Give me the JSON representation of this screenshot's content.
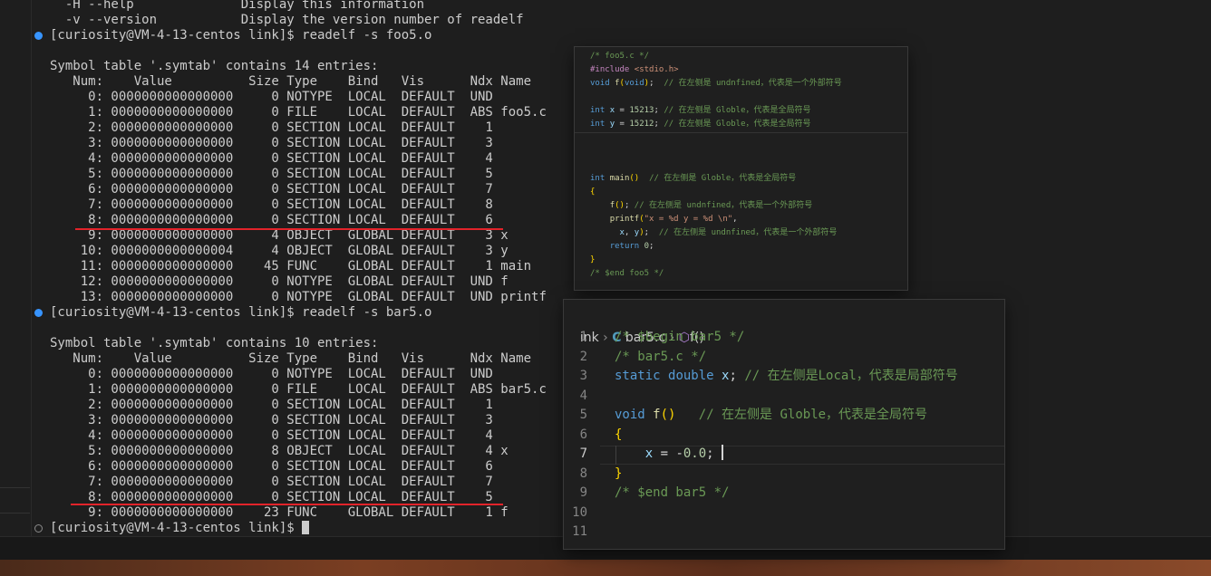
{
  "terminal": {
    "lines": [
      {
        "text": "  -H --help              Display this information",
        "y": -3
      },
      {
        "text": "  -v --version           Display the version number of readelf"
      },
      {
        "text": "[curiosity@VM-4-13-centos link]$ readelf -s foo5.o",
        "prompt": true
      },
      {
        "text": ""
      },
      {
        "text": "Symbol table '.symtab' contains 14 entries:"
      },
      {
        "text": "   Num:    Value          Size Type    Bind   Vis      Ndx Name"
      },
      {
        "text": "     0: 0000000000000000     0 NOTYPE  LOCAL  DEFAULT  UND"
      },
      {
        "text": "     1: 0000000000000000     0 FILE    LOCAL  DEFAULT  ABS foo5.c"
      },
      {
        "text": "     2: 0000000000000000     0 SECTION LOCAL  DEFAULT    1"
      },
      {
        "text": "     3: 0000000000000000     0 SECTION LOCAL  DEFAULT    3"
      },
      {
        "text": "     4: 0000000000000000     0 SECTION LOCAL  DEFAULT    4"
      },
      {
        "text": "     5: 0000000000000000     0 SECTION LOCAL  DEFAULT    5"
      },
      {
        "text": "     6: 0000000000000000     0 SECTION LOCAL  DEFAULT    7"
      },
      {
        "text": "     7: 0000000000000000     0 SECTION LOCAL  DEFAULT    8"
      },
      {
        "text": "     8: 0000000000000000     0 SECTION LOCAL  DEFAULT    6"
      },
      {
        "text": "     9: 0000000000000000     4 OBJECT  GLOBAL DEFAULT    3 x"
      },
      {
        "text": "    10: 0000000000000004     4 OBJECT  GLOBAL DEFAULT    3 y"
      },
      {
        "text": "    11: 0000000000000000    45 FUNC    GLOBAL DEFAULT    1 main"
      },
      {
        "text": "    12: 0000000000000000     0 NOTYPE  GLOBAL DEFAULT  UND f"
      },
      {
        "text": "    13: 0000000000000000     0 NOTYPE  GLOBAL DEFAULT  UND printf"
      },
      {
        "text": "[curiosity@VM-4-13-centos link]$ readelf -s bar5.o",
        "prompt": true
      },
      {
        "text": ""
      },
      {
        "text": "Symbol table '.symtab' contains 10 entries:"
      },
      {
        "text": "   Num:    Value          Size Type    Bind   Vis      Ndx Name"
      },
      {
        "text": "     0: 0000000000000000     0 NOTYPE  LOCAL  DEFAULT  UND"
      },
      {
        "text": "     1: 0000000000000000     0 FILE    LOCAL  DEFAULT  ABS bar5.c"
      },
      {
        "text": "     2: 0000000000000000     0 SECTION LOCAL  DEFAULT    1"
      },
      {
        "text": "     3: 0000000000000000     0 SECTION LOCAL  DEFAULT    3"
      },
      {
        "text": "     4: 0000000000000000     0 SECTION LOCAL  DEFAULT    4"
      },
      {
        "text": "     5: 0000000000000000     8 OBJECT  LOCAL  DEFAULT    4 x"
      },
      {
        "text": "     6: 0000000000000000     0 SECTION LOCAL  DEFAULT    6"
      },
      {
        "text": "     7: 0000000000000000     0 SECTION LOCAL  DEFAULT    7"
      },
      {
        "text": "     8: 0000000000000000     0 SECTION LOCAL  DEFAULT    5"
      },
      {
        "text": "     9: 0000000000000000    23 FUNC    GLOBAL DEFAULT    1 f"
      },
      {
        "text": "[curiosity@VM-4-13-centos link]$ ",
        "prompt": true,
        "cursor": true,
        "inactive": true
      }
    ]
  },
  "small_editor": {
    "lines": [
      "/* foo5.c */",
      "#include <stdio.h>",
      "void f(void);  // 在左侧是 undnfined，代表是一个外部符号",
      "",
      "int x = 15213; // 在左侧是 Globle，代表是全局符号",
      "int y = 15212; // 在左侧是 Globle，代表是全局符号",
      "",
      "",
      "",
      "int main()  // 在左侧是 Globle，代表是全局符号",
      "{",
      "    f(); // 在左侧是 undnfined，代表是一个外部符号",
      "    printf(\"x = %d y = %d \\n\",",
      "      x, y);  // 在左侧是 undnfined，代表是一个外部符号",
      "    return 0;",
      "}",
      "/* $end foo5 */"
    ]
  },
  "large_editor": {
    "breadcrumb": {
      "folder": "ink",
      "file_icon": "C",
      "file": "bar5.c",
      "symbol": "f()"
    },
    "lines": [
      {
        "num": "1",
        "text": "/* $begin bar5 */"
      },
      {
        "num": "2",
        "text": "/* bar5.c */"
      },
      {
        "num": "3",
        "text": "static double x; // 在左侧是Local，代表是局部符号"
      },
      {
        "num": "4",
        "text": ""
      },
      {
        "num": "5",
        "text": "void f()   // 在左侧是 Globle，代表是全局符号"
      },
      {
        "num": "6",
        "text": "{"
      },
      {
        "num": "7",
        "text": "    x = -0.0; "
      },
      {
        "num": "8",
        "text": "}"
      },
      {
        "num": "9",
        "text": "/* $end bar5 */"
      },
      {
        "num": "10",
        "text": ""
      },
      {
        "num": "11",
        "text": ""
      }
    ],
    "active_line": "7"
  },
  "colors": {
    "terminal_bg": "#1e1e1e",
    "terminal_fg": "#cccccc",
    "prompt_dot": "#3794ff",
    "underline": "#e2232a",
    "comment": "#6a9955",
    "keyword": "#569cd6"
  }
}
